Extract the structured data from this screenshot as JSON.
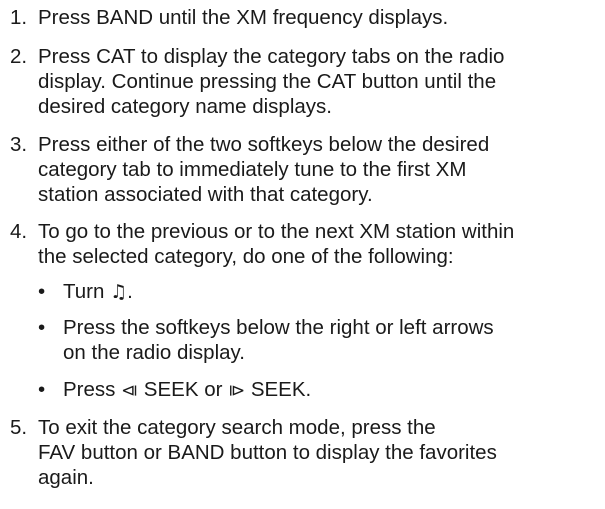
{
  "steps": [
    {
      "num": "1.",
      "text": "Press BAND until the XM frequency displays."
    },
    {
      "num": "2.",
      "lines": [
        "Press CAT to display the category tabs on the radio",
        "display. Continue pressing the CAT button until the",
        "desired category name displays."
      ]
    },
    {
      "num": "3.",
      "lines": [
        "Press either of the two softkeys below the desired",
        "category tab to immediately tune to the first XM",
        "station associated with that category."
      ]
    },
    {
      "num": "4.",
      "lines": [
        "To go to the previous or to the next XM station within",
        "the selected category, do one of the following:"
      ]
    },
    {
      "num": "5.",
      "lines": [
        "To exit the category search mode, press the",
        "FAV button or BAND button to display the favorites",
        "again."
      ]
    }
  ],
  "bullets": {
    "dot": "•",
    "turn": {
      "pre": "Turn ",
      "icon": "♫",
      "post": "."
    },
    "softkeys": [
      "Press the softkeys below the right or left arrows",
      "on the radio display."
    ],
    "seek": {
      "pre": "Press ",
      "icon_prev": "⧏",
      "mid": " SEEK or ",
      "icon_next": "⧐",
      "post": " SEEK."
    }
  }
}
